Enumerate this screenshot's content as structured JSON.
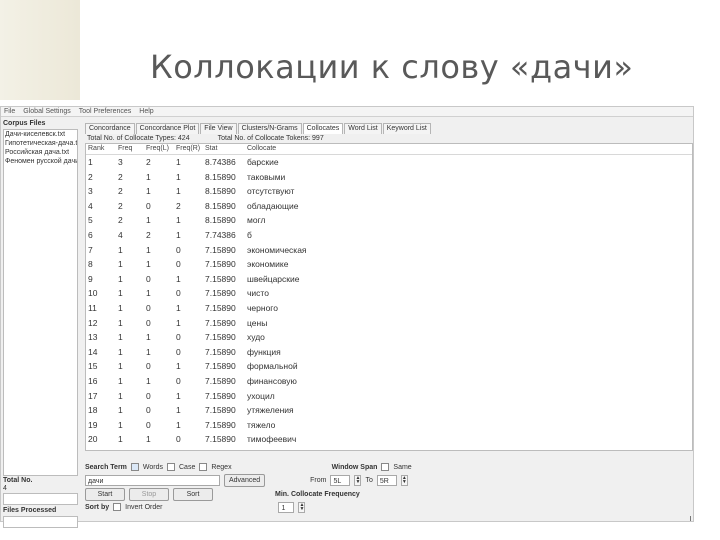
{
  "slide": {
    "title": "Коллокации к слову «дачи»"
  },
  "menu": [
    "File",
    "Global Settings",
    "Tool Preferences",
    "Help"
  ],
  "left_panel": {
    "title": "Corpus Files",
    "files": [
      "Дачи-киселевск.txt",
      "Гипотетическая-дача.txt",
      "Российская дача.txt",
      "Феномен русской дачи"
    ],
    "total_label": "Total No.",
    "total_value": "4",
    "processed_label": "Files Processed"
  },
  "tabs": [
    "Concordance",
    "Concordance Plot",
    "File View",
    "Clusters/N-Grams",
    "Collocates",
    "Word List",
    "Keyword List"
  ],
  "active_tab": "Collocates",
  "summary": {
    "types": "Total No. of Collocate Types: 424",
    "tokens": "Total No. of Collocate Tokens: 997"
  },
  "columns": [
    "Rank",
    "Freq",
    "Freq(L)",
    "Freq(R)",
    "Stat",
    "Collocate"
  ],
  "rows": [
    [
      "1",
      "3",
      "2",
      "1",
      "8.74386",
      "барские"
    ],
    [
      "2",
      "2",
      "1",
      "1",
      "8.15890",
      "таковыми"
    ],
    [
      "3",
      "2",
      "1",
      "1",
      "8.15890",
      "отсутствуют"
    ],
    [
      "4",
      "2",
      "0",
      "2",
      "8.15890",
      "обладающие"
    ],
    [
      "5",
      "2",
      "1",
      "1",
      "8.15890",
      "могл"
    ],
    [
      "6",
      "4",
      "2",
      "1",
      "7.74386",
      "б"
    ],
    [
      "7",
      "1",
      "1",
      "0",
      "7.15890",
      "экономическая"
    ],
    [
      "8",
      "1",
      "1",
      "0",
      "7.15890",
      "экономике"
    ],
    [
      "9",
      "1",
      "0",
      "1",
      "7.15890",
      "швейцарские"
    ],
    [
      "10",
      "1",
      "1",
      "0",
      "7.15890",
      "чисто"
    ],
    [
      "11",
      "1",
      "0",
      "1",
      "7.15890",
      "черного"
    ],
    [
      "12",
      "1",
      "0",
      "1",
      "7.15890",
      "цены"
    ],
    [
      "13",
      "1",
      "1",
      "0",
      "7.15890",
      "худо"
    ],
    [
      "14",
      "1",
      "1",
      "0",
      "7.15890",
      "функция"
    ],
    [
      "15",
      "1",
      "0",
      "1",
      "7.15890",
      "формальной"
    ],
    [
      "16",
      "1",
      "1",
      "0",
      "7.15890",
      "финансовую"
    ],
    [
      "17",
      "1",
      "0",
      "1",
      "7.15890",
      "ухоцил"
    ],
    [
      "18",
      "1",
      "0",
      "1",
      "7.15890",
      "утяжеления"
    ],
    [
      "19",
      "1",
      "0",
      "1",
      "7.15890",
      "тяжело"
    ],
    [
      "20",
      "1",
      "1",
      "0",
      "7.15890",
      "тимофеевич"
    ]
  ],
  "search": {
    "term_label": "Search Term",
    "words_label": "Words",
    "case_label": "Case",
    "regex_label": "Regex",
    "term_value": "дачи",
    "advanced_label": "Advanced",
    "start_label": "Start",
    "stop_label": "Stop",
    "sort_label": "Sort",
    "window_span_label": "Window Span",
    "same_label": "Same",
    "from_label": "From",
    "from_value": "5L",
    "to_label": "To",
    "to_value": "5R",
    "min_freq_label": "Min. Collocate Frequency",
    "min_freq_value": "1",
    "sort_by_label": "Sort by",
    "invert_label": "Invert Order"
  }
}
